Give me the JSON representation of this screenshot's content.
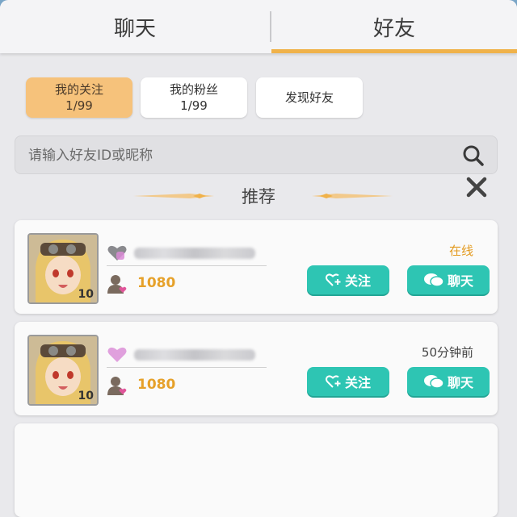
{
  "tabs": {
    "chat": "聊天",
    "friends": "好友"
  },
  "subtabs": [
    {
      "label": "我的关注",
      "count": "1/99"
    },
    {
      "label": "我的粉丝",
      "count": "1/99"
    },
    {
      "label": "发现好友"
    }
  ],
  "search": {
    "placeholder": "请输入好友ID或昵称"
  },
  "recommend": {
    "title": "推荐"
  },
  "cards": [
    {
      "level": "10",
      "power": "1080",
      "status": "在线",
      "status_color": "#e39a1e",
      "follow_label": "关注",
      "chat_label": "聊天"
    },
    {
      "level": "10",
      "power": "1080",
      "status": "50分钟前",
      "status_color": "#444444",
      "follow_label": "关注",
      "chat_label": "聊天"
    }
  ],
  "colors": {
    "accent": "#f0b24a",
    "button": "#2ec5b3",
    "power": "#e6a12a"
  }
}
